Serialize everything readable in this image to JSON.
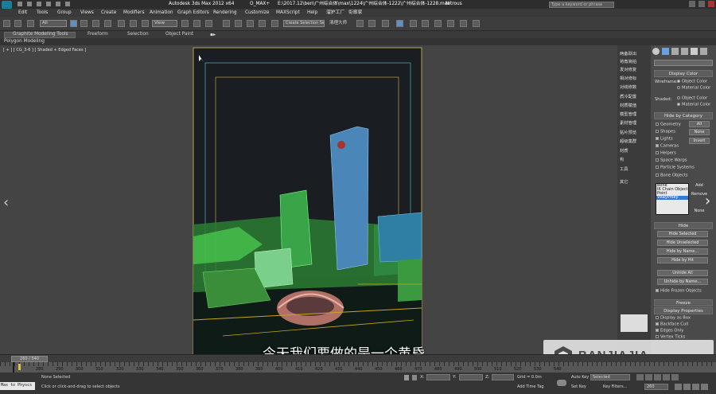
{
  "title": {
    "app": "Autodesk 3ds Max 2012 x64",
    "tab": "O_MAX+",
    "path": "E:\\2017.12\\ben\\广州综合体\\max\\1224\\广州综合体-1222\\广州综合体-1228.max",
    "renderer": "Nitrous",
    "search_placeholder": "Type a keyword or phrase"
  },
  "menu": [
    "Edit",
    "Tools",
    "Group",
    "Views",
    "Create",
    "Modifiers",
    "Animation",
    "Graph Editors",
    "Rendering",
    "Customize",
    "MAXScript",
    "Help",
    "溜护工厂",
    "衔廓家"
  ],
  "toolbar": {
    "selection_filter": "All",
    "ref_coord": "View",
    "named_set": "Create Selection Se",
    "extra_label": "清理大师"
  },
  "ribbon": {
    "tabs": [
      "Graphite Modeling Tools",
      "Freeform",
      "Selection",
      "Object Paint"
    ],
    "sub": "Polygon Modeling"
  },
  "viewport": {
    "label": "[ + ] [ CG_3-6 ] [ Shaded + Edged Faces ]"
  },
  "command_strip": [
    "两备跃出",
    "将角简拍",
    "发对修复",
    "相对修标",
    "对线修数",
    "质冷配置",
    "材质赋值",
    "模型管理",
    "素材管理",
    "贴片预览",
    "超级集群",
    "材质",
    "构",
    "工具",
    "其它"
  ],
  "right_panel": {
    "display_color": "Display Color",
    "wireframe": "Wireframe:",
    "shaded": "Shaded:",
    "object_color": "Object Color",
    "material_color": "Material Color",
    "hide_by_category": "Hide by Category",
    "categories": [
      "Geometry",
      "Shapes",
      "Lights",
      "Cameras",
      "Helpers",
      "Space Warps",
      "Particle Systems",
      "Bone Objects"
    ],
    "cat_on": [
      false,
      false,
      true,
      true,
      false,
      false,
      false,
      false
    ],
    "cat_btns": [
      "All",
      "None",
      "Invert"
    ],
    "list": [
      "Bone",
      "IK Chain Object",
      "Point",
      "VRayProxy"
    ],
    "list_btns": [
      "Add",
      "Remove",
      "None"
    ],
    "hide_head": "Hide",
    "hide_btns": [
      "Hide Selected",
      "Hide Unselected",
      "Hide by Name...",
      "Hide by Hit",
      "Unhide All",
      "Unhide by Name..."
    ],
    "hide_frozen": "Hide Frozen Objects",
    "freeze_head": "Freeze",
    "props_head": "Display Properties",
    "props": [
      "Display as Box",
      "Backface Cull",
      "Edges Only",
      "Vertex Ticks"
    ]
  },
  "timeline": {
    "frame": "260 / 540",
    "ticks": [
      "280",
      "290",
      "300",
      "310",
      "320",
      "330",
      "340",
      "350",
      "360",
      "370",
      "380",
      "390",
      "400",
      "410",
      "420",
      "430",
      "440",
      "450",
      "460",
      "470",
      "480",
      "490",
      "500",
      "510",
      "520",
      "530",
      "540"
    ]
  },
  "status": {
    "script": "Max to Physcs",
    "selected": "None Selected",
    "prompt": "Click or click-and-drag to select objects",
    "x_label": "X:",
    "y_label": "Y:",
    "z_label": "Z:",
    "grid": "Grid = 0.0m",
    "add_tag": "Add Time Tag",
    "autokey": "Auto Key",
    "autokey_val": "Selected",
    "setkey": "Set Key",
    "keyfilters": "Key Filters...",
    "frame_val": "260"
  },
  "subtitle": "今天我们要做的是一个黄昏",
  "watermark": "BANJIAJIA"
}
